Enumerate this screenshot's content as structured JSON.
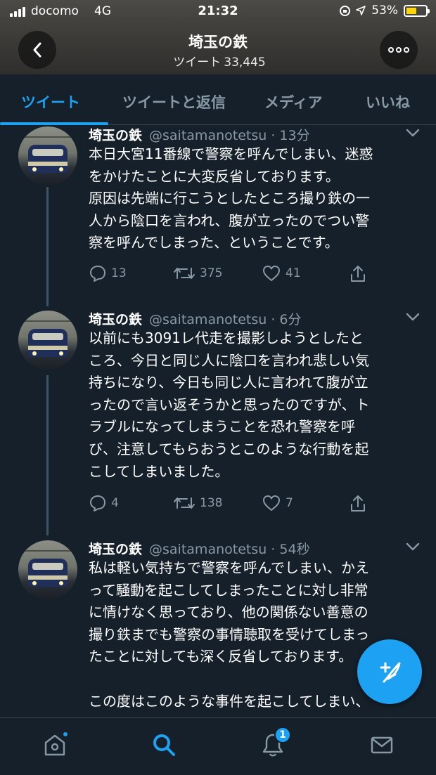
{
  "status_bar": {
    "carrier": "docomo",
    "network": "4G",
    "time": "21:32",
    "battery": "53%",
    "battery_level": 0.53
  },
  "header": {
    "title": "埼玉の鉄",
    "tweets_label": "ツイート",
    "tweets_count": "33,445"
  },
  "tabs": [
    {
      "label": "ツイート",
      "active": true
    },
    {
      "label": "ツイートと返信",
      "active": false
    },
    {
      "label": "メディア",
      "active": false
    },
    {
      "label": "いいね",
      "active": false
    }
  ],
  "tweets": [
    {
      "author": "埼玉の鉄",
      "handle_time": "@saitamanotetsu · 13分",
      "text": "本日大宮11番線で警察を呼んでしまい、迷惑\nをかけたことに大変反省しております。\n原因は先端に行こうとしたところ撮り鉄の一\n人から陰口を言われ、腹が立ったのでつい警\n察を呼んでしまった、ということです。",
      "replies": "13",
      "retweets": "375",
      "likes": "41"
    },
    {
      "author": "埼玉の鉄",
      "handle_time": "@saitamanotetsu · 6分",
      "text": "以前にも3091レ代走を撮影しようとしたと\nころ、今日と同じ人に陰口を言われ悲しい気\n持ちになり、今日も同じ人に言われて腹が立\nったので言い返そうかと思ったのですが、ト\nラブルになってしまうことを恐れ警察を呼\nび、注意してもらおうとこのような行動を起\nこしてしまいました。",
      "replies": "4",
      "retweets": "138",
      "likes": "7"
    },
    {
      "author": "埼玉の鉄",
      "handle_time": "@saitamanotetsu · 54秒",
      "text": "私は軽い気持ちで警察を呼んでしまい、かえ\nって騒動を起こしてしまったことに対し非常\nに情けなく思っており、他の関係ない善意の\n撮り鉄までも警察の事情聴取を受けてしまっ\nたことに対しても深く反省しております。\n\nこの度はこのような事件を起こしてしまい、"
    }
  ],
  "bottom_nav": {
    "notifications_badge": "1"
  },
  "colors": {
    "background": "#15202b",
    "accent": "#1da1f2",
    "muted": "#8899a6",
    "divider": "#38444d"
  },
  "icons": [
    "back-arrow-icon",
    "more-icon",
    "chevron-down-icon",
    "reply-icon",
    "retweet-icon",
    "like-icon",
    "share-icon",
    "compose-icon",
    "home-icon",
    "search-icon",
    "notifications-icon",
    "messages-icon"
  ]
}
